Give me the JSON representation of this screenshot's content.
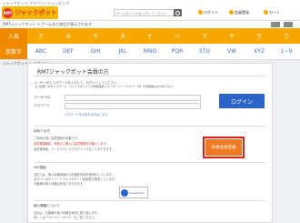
{
  "topbar": {
    "text": "ジャックポット-アカウントショッピング"
  },
  "header": {
    "logo_text": "ジャックポット",
    "logo_badge": "RMT",
    "search_placeholder": "ゲームタイトルを入力してください",
    "links": [
      "ログイン",
      "会員登録",
      "カート"
    ]
  },
  "breadcrumb": {
    "text": "RMTジャックポット > ゲーム名と商品が表示されます"
  },
  "kana_nav": [
    "人気",
    "ア",
    "カ",
    "サ",
    "タ",
    "ナ",
    "ハ",
    "マ",
    "ヤ",
    "ラ",
    "ワ"
  ],
  "alpha_nav": [
    "英数字",
    "ABC",
    "DEF",
    "GHI",
    "JKL",
    "MNO",
    "PQR",
    "STU",
    "VW",
    "XYZ",
    "1~9"
  ],
  "subtitle": {
    "text": "ジャックポット > ログイン"
  },
  "panel": {
    "title": "RMTジャックポット会員の方",
    "login_note": "ユーザーIDとパスワードを入力して、ログインしてください。",
    "login_note2": "【ご注意】IDやパスワード、ジャックポットへの登録情報【インターパーソナルデータ】の登録等はおやめ下さい。",
    "id_label": "ユーザーID",
    "password_label": "パスワード",
    "forgot_link": "パスワードをお忘れの方はこちら",
    "login_button": "ログイン",
    "new_title": "初めての方",
    "new_text1": "ご利用の前に会員登録が必要です。",
    "new_text2": "会員登録無料、商品のご購入に会員登録をお願いします。",
    "new_text3": "会員登録後、メールアドレスでログインすることができます。",
    "register_button": "新規会員登録",
    "ssl_title": "SSL認証",
    "ssl_text1": "当社では、個人情報保護のため通信内容を暗号化しています。",
    "ssl_text2": "当サイトはサイバートラストのサーバ証明書を使用しています。",
    "ssl_text3": "お客様の個人情報は安全に守られます。",
    "badge_text": "SureServer",
    "policy_title": "個人情報について",
    "policy_text1": "当社は、お客様の個人情報を適切に取り扱います。",
    "policy_text2": "詳しくはプライバシーポリシーをご覧ください。"
  },
  "colors": {
    "accent": "#f6a800",
    "brand_red": "#e03a2b",
    "login_blue": "#2a64c8",
    "register_orange": "#f07a22"
  }
}
